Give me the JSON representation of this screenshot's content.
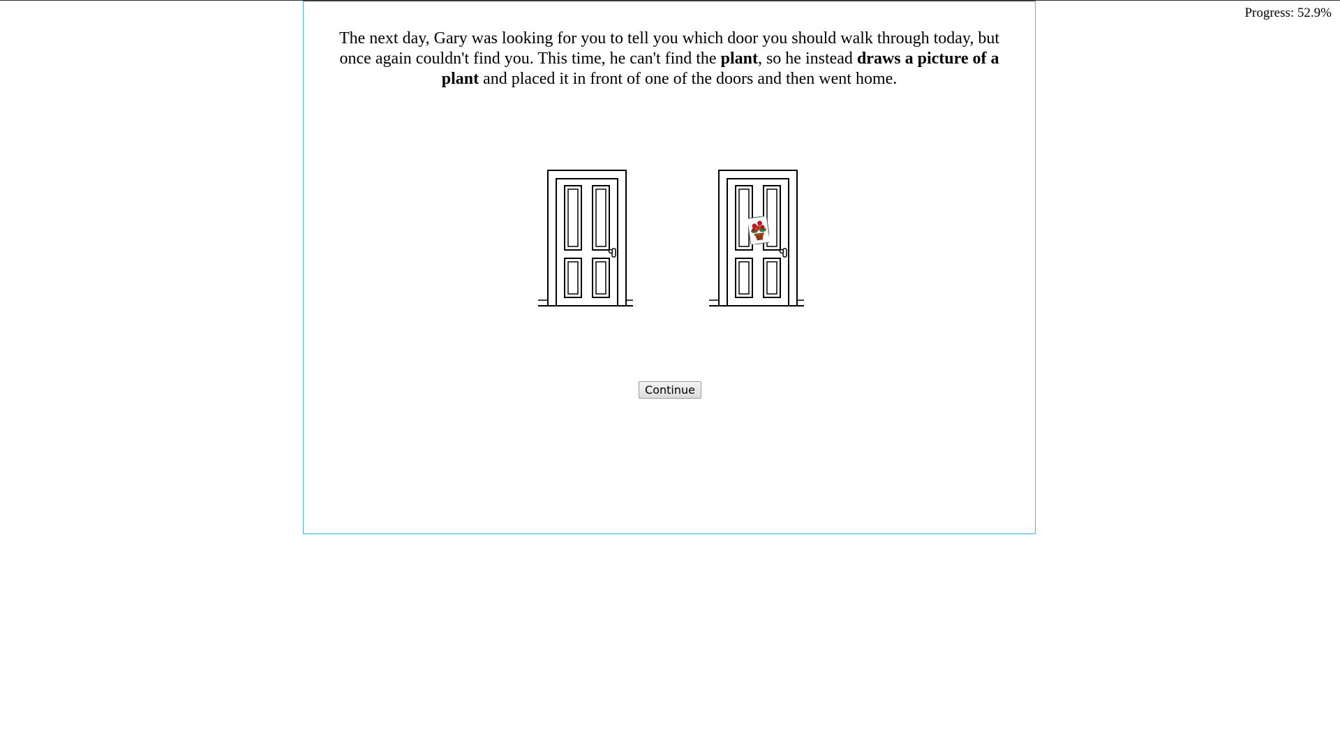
{
  "progress": {
    "text": "Progress: 52.9%",
    "value_percent": 52.9
  },
  "story": {
    "part1": "The next day, Gary was looking for you to tell you which door you should walk through today, but once again couldn't find you. This time, he can't find the ",
    "bold1": "plant",
    "part2": ", so he instead ",
    "bold2": "draws a picture of a plant",
    "part3": " and placed it in front of one of the doors and then went home."
  },
  "doors": [
    {
      "name": "left-door",
      "has_plant_picture": false
    },
    {
      "name": "right-door",
      "has_plant_picture": true
    }
  ],
  "continue_label": "Continue",
  "colors": {
    "panel_border": "#4fb7e6",
    "plant_red": "#c8161d",
    "plant_green": "#2f7d2a",
    "pot_brown": "#8b3a1a"
  }
}
